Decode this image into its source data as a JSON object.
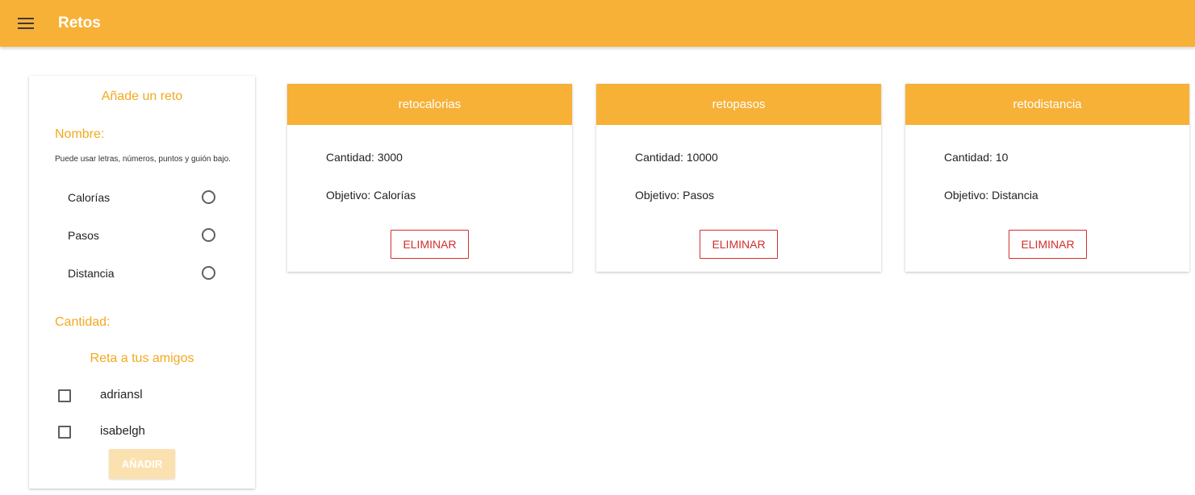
{
  "toolbar": {
    "title": "Retos",
    "menu_icon": "menu-icon"
  },
  "form": {
    "title": "Añade un reto",
    "name_label": "Nombre:",
    "name_hint": "Puede usar letras, números, puntos y guión bajo.",
    "objective_options": [
      "Calorías",
      "Pasos",
      "Distancia"
    ],
    "quantity_label": "Cantidad:",
    "friends_title": "Reta a tus amigos",
    "friends": [
      "adriansl",
      "isabelgh"
    ],
    "add_button": "AÑADIR"
  },
  "challenges": [
    {
      "name": "retocalorias",
      "quantity": "Cantidad: 3000",
      "objective": "Objetivo: Calorías",
      "delete_label": "ELIMINAR"
    },
    {
      "name": "retopasos",
      "quantity": "Cantidad: 10000",
      "objective": "Objetivo: Pasos",
      "delete_label": "ELIMINAR"
    },
    {
      "name": "retodistancia",
      "quantity": "Cantidad: 10",
      "objective": "Objetivo: Distancia",
      "delete_label": "ELIMINAR"
    }
  ],
  "colors": {
    "accent": "#f7b137",
    "label": "#f2a91e",
    "danger": "#d32f2f",
    "disabled_button": "#fce1b0"
  }
}
